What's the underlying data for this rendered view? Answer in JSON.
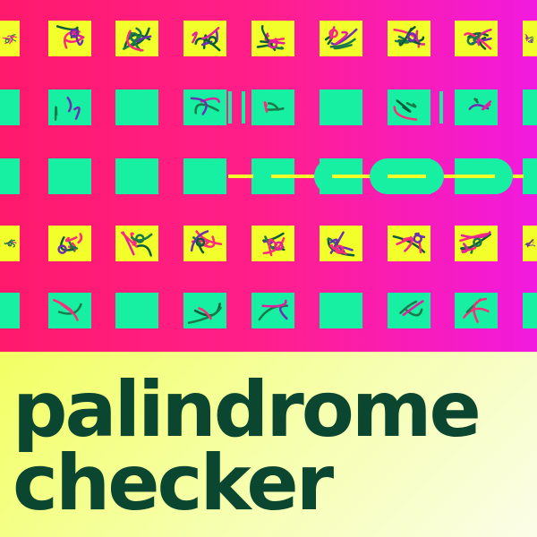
{
  "title": {
    "line1": "palindrome",
    "line2": "checker"
  },
  "colors": {
    "grid_background": "#ff1f8c",
    "tile_yellow": "#f2ff2a",
    "tile_teal": "#17f0a3",
    "title_text": "#0b4631",
    "title_background": "#f6ffb0"
  },
  "grid": {
    "rows": [
      {
        "kind": "yellow",
        "glyph": "scribble"
      },
      {
        "kind": "teal",
        "glyph": "sparse"
      },
      {
        "kind": "teal",
        "glyph": "mirrored-link"
      },
      {
        "kind": "yellow",
        "glyph": "scribble"
      },
      {
        "kind": "teal",
        "glyph": "sparse"
      }
    ]
  }
}
